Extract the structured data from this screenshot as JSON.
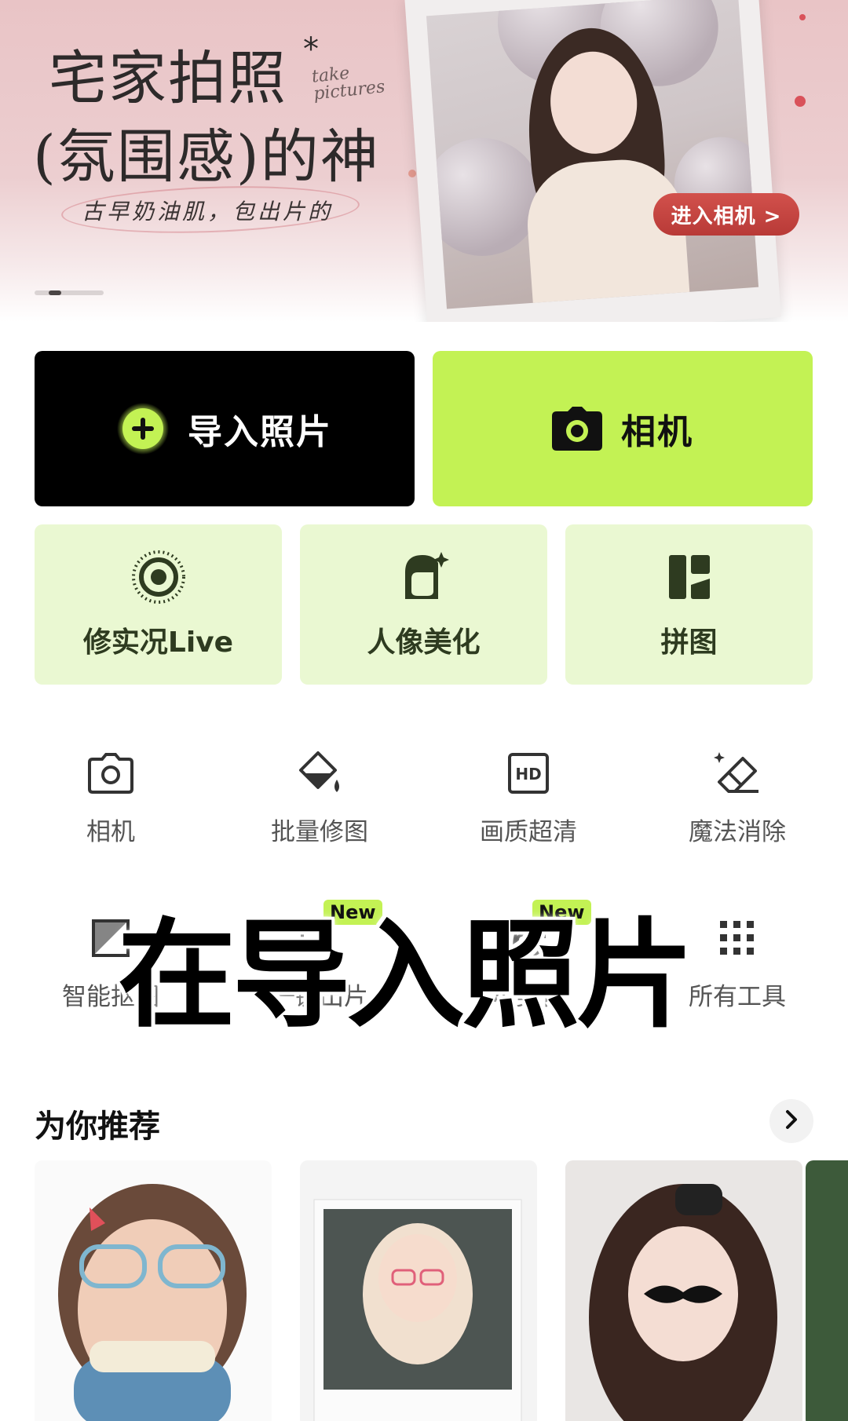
{
  "banner": {
    "headline_line1": "宅家拍照",
    "headline_line2": "(氛围感)的神",
    "script_text": "take pictures",
    "slogan": "古早奶油肌，包出片的",
    "cta_label": "进入相机 >",
    "pager_count": 1
  },
  "primary_actions": {
    "import_label": "导入照片",
    "camera_label": "相机"
  },
  "feature_tiles": [
    {
      "label": "修实况Live",
      "icon": "live-photo-icon"
    },
    {
      "label": "人像美化",
      "icon": "portrait-icon"
    },
    {
      "label": "拼图",
      "icon": "collage-icon"
    }
  ],
  "tools_row1": [
    {
      "label": "相机",
      "icon": "camera-outline-icon"
    },
    {
      "label": "批量修图",
      "icon": "paint-bucket-icon"
    },
    {
      "label": "画质超清",
      "icon": "hd-icon"
    },
    {
      "label": "魔法消除",
      "icon": "eraser-icon"
    }
  ],
  "tools_row2": [
    {
      "label": "智能抠图",
      "icon": "smart-cutout-icon",
      "badge": ""
    },
    {
      "label": "一键出片",
      "icon": "one-tap-icon",
      "badge": "New"
    },
    {
      "label": "AI美化",
      "icon": "ai-beauty-icon",
      "badge": "New"
    },
    {
      "label": "所有工具",
      "icon": "grid-dots-icon",
      "badge": ""
    }
  ],
  "overlay_caption": "在导入照片",
  "recommend": {
    "title": "为你推荐"
  },
  "colors": {
    "accent_green": "#c3f254",
    "tile_bg": "#eaf8d2",
    "tile_icon": "#2e3b20",
    "cta_red": "#c2403c"
  }
}
